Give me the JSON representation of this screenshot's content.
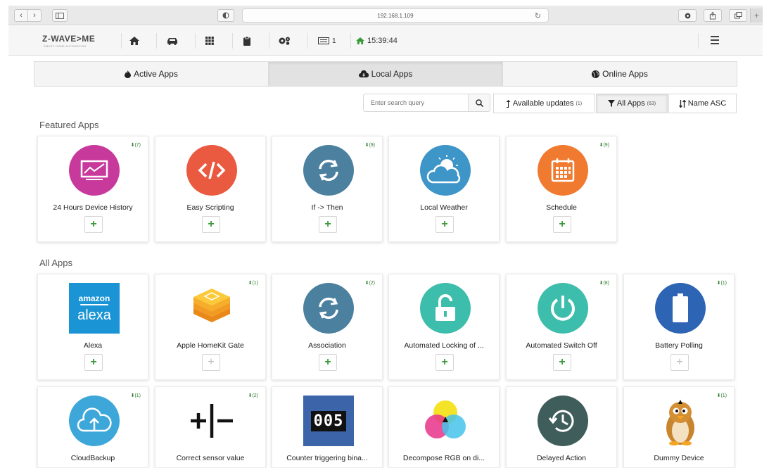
{
  "browser": {
    "address": "192.168.1.109"
  },
  "navbar": {
    "logo": "Z-WAVE>ME",
    "logo_tagline": "SMART HOME AUTOMATION",
    "count_label": "1",
    "time": "15:39:44"
  },
  "tabs": [
    {
      "label": "Active Apps",
      "icon": "fire-icon"
    },
    {
      "label": "Local Apps",
      "icon": "cloud-download-icon"
    },
    {
      "label": "Online Apps",
      "icon": "globe-icon"
    }
  ],
  "filters": {
    "search_placeholder": "Enter search query",
    "updates_label": "Available updates",
    "updates_count": "(1)",
    "all_apps_label": "All Apps",
    "all_apps_count": "(63)",
    "sort_label": "Name ASC"
  },
  "featured": {
    "title": "Featured Apps",
    "apps": [
      {
        "name": "24 Hours Device History",
        "badge": "(7)",
        "icon": "chart-monitor-icon",
        "color": "#c0399a"
      },
      {
        "name": "Easy Scripting",
        "badge": "",
        "icon": "code-icon",
        "color": "#e9573f"
      },
      {
        "name": "If -> Then",
        "badge": "(9)",
        "icon": "refresh-icon",
        "color": "#4a7fa0"
      },
      {
        "name": "Local Weather",
        "badge": "",
        "icon": "weather-icon",
        "color": "#3c94c9"
      },
      {
        "name": "Schedule",
        "badge": "(9)",
        "icon": "calendar-icon",
        "color": "#f0782f"
      }
    ]
  },
  "all": {
    "title": "All Apps",
    "apps": [
      {
        "name": "Alexa",
        "badge": "",
        "icon": "alexa-logo",
        "color": "#1a93d4",
        "logo_top": "amazon",
        "logo_bottom": "alexa"
      },
      {
        "name": "Apple HomeKit Gate",
        "badge": "(1)",
        "icon": "homekit-icon",
        "color": "#f5a623"
      },
      {
        "name": "Association",
        "badge": "(2)",
        "icon": "refresh-icon",
        "color": "#4a7fa0"
      },
      {
        "name": "Automated Locking of ...",
        "badge": "",
        "icon": "unlock-icon",
        "color": "#3dbcab"
      },
      {
        "name": "Automated Switch Off",
        "badge": "(8)",
        "icon": "power-icon",
        "color": "#3dbcab"
      },
      {
        "name": "Battery Polling",
        "badge": "(1)",
        "icon": "battery-icon",
        "color": "#2d63b5"
      },
      {
        "name": "CloudBackup",
        "badge": "(1)",
        "icon": "cloud-upload-icon",
        "color": "#3da6d8"
      },
      {
        "name": "Correct sensor value",
        "badge": "(2)",
        "icon": "plus-minus-icon",
        "color": "#111111"
      },
      {
        "name": "Counter triggering bina...",
        "badge": "",
        "icon": "counter-icon",
        "color": "#3a64a8",
        "counter_text": "005"
      },
      {
        "name": "Decompose RGB on di...",
        "badge": "",
        "icon": "rgb-circles-icon",
        "color": "#e94c8a"
      },
      {
        "name": "Delayed Action",
        "badge": "",
        "icon": "history-icon",
        "color": "#3f5c5a"
      },
      {
        "name": "Dummy Device",
        "badge": "(1)",
        "icon": "penguin-icon",
        "color": "#e8a43c"
      }
    ]
  }
}
